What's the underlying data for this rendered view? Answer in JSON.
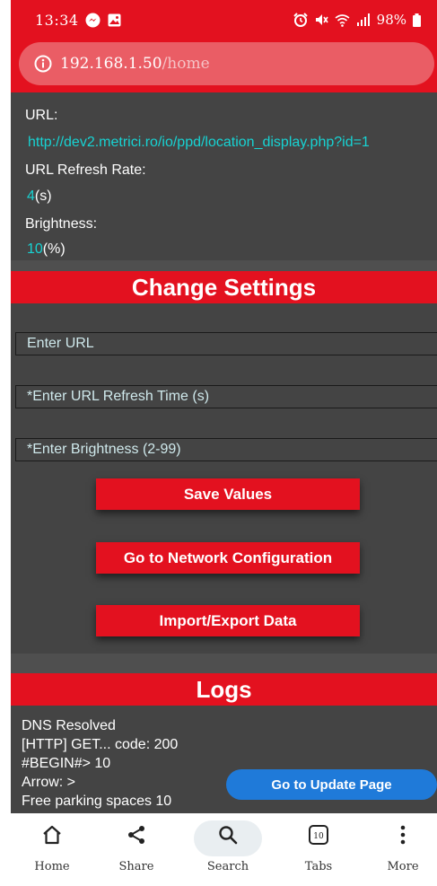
{
  "status_bar": {
    "time": "13:34",
    "battery": "98%"
  },
  "browser": {
    "url_host": "192.168.1.50",
    "url_path": "/home"
  },
  "info": {
    "url_label": "URL:",
    "url_value": "http://dev2.metrici.ro/io/ppd/location_display.php?id=1",
    "refresh_label": "URL Refresh Rate:",
    "refresh_value": "4",
    "refresh_unit": "(s)",
    "brightness_label": "Brightness:",
    "brightness_value": "10",
    "brightness_unit": "(%)"
  },
  "change_settings": {
    "title": "Change Settings",
    "url_placeholder": "Enter URL",
    "refresh_placeholder": "*Enter URL Refresh Time (s)",
    "brightness_placeholder": "*Enter Brightness (2-99)",
    "save_label": "Save Values",
    "network_label": "Go to Network Configuration",
    "import_export_label": "Import/Export Data"
  },
  "logs": {
    "title": "Logs",
    "lines": [
      "DNS Resolved",
      "[HTTP] GET... code: 200",
      "#BEGIN#> 10",
      "Arrow: >",
      "Free parking spaces 10"
    ],
    "update_label": "Go to Update Page"
  },
  "nav": {
    "items": [
      {
        "label": "Home",
        "icon": "home-icon"
      },
      {
        "label": "Share",
        "icon": "share-icon"
      },
      {
        "label": "Search",
        "icon": "search-icon"
      },
      {
        "label": "Tabs",
        "icon": "tabs-icon",
        "count": "10"
      },
      {
        "label": "More",
        "icon": "more-icon"
      }
    ]
  },
  "colors": {
    "brand_red": "#e3111f",
    "panel_gray": "#444444",
    "cyan_value": "#17d3d3",
    "update_blue": "#1f7ad9"
  }
}
